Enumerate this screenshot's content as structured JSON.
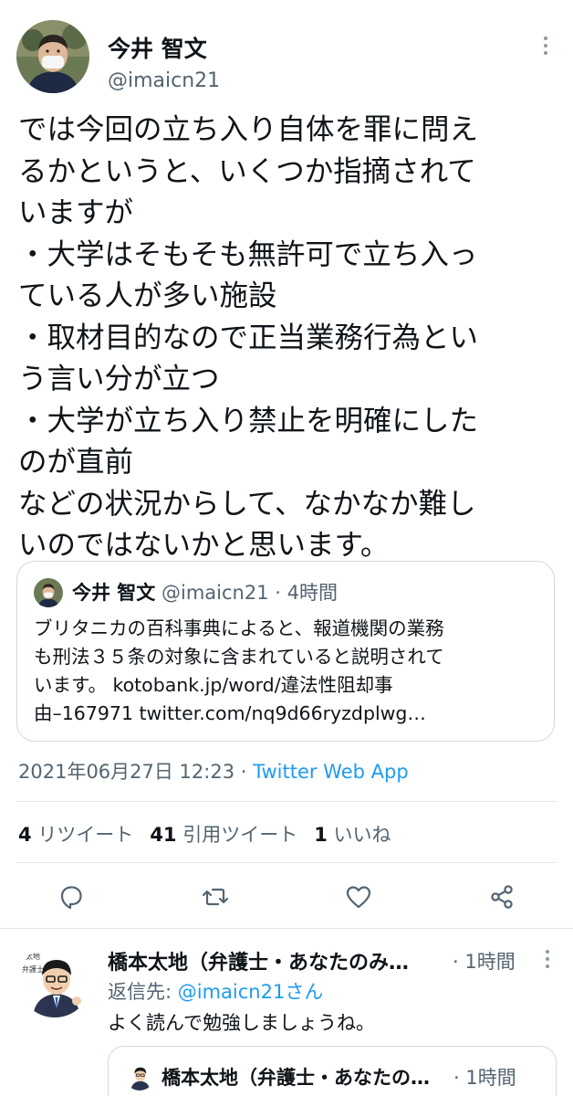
{
  "tweet": {
    "author_name": "今井 智文",
    "author_handle": "@imaicn21",
    "body_lines": [
      "では今回の立ち入り自体を罪に問え",
      "るかというと、いくつか指摘されて",
      "いますが",
      "・大学はそもそも無許可で立ち入っ",
      "ている人が多い施設",
      "・取材目的なので正当業務行為とい",
      "う言い分が立つ",
      "・大学が立ち入り禁止を明確にした",
      "のが直前",
      "などの状況からして、なかなか難し",
      "いのではないかと思います。"
    ],
    "timestamp": "2021年06月27日 12:23",
    "separator": " · ",
    "source": "Twitter Web App",
    "stats": {
      "retweets_count": "4",
      "retweets_label": "リツイート",
      "quotes_count": "41",
      "quotes_label": "引用ツイート",
      "likes_count": "1",
      "likes_label": "いいね"
    }
  },
  "quoted_tweet": {
    "author_name": "今井 智文",
    "author_handle": "@imaicn21",
    "time": "4時間",
    "separator": " · ",
    "body_lines": [
      "ブリタニカの百科事典によると、報道機関の業務",
      "も刑法３５条の対象に含まれていると説明されて",
      "います。 kotobank.jp/word/違法性阻却事",
      "由–167971 twitter.com/nq9d66ryzdplwg…"
    ]
  },
  "actions": {
    "reply_icon": "comment-icon",
    "retweet_icon": "retweet-icon",
    "like_icon": "heart-icon",
    "share_icon": "share-icon"
  },
  "reply": {
    "author_name": "橋本太地（弁護士・あなたのみ…",
    "separator": " · ",
    "time": "1時間",
    "reply_to_label": "返信先: ",
    "reply_to_mention": "@imaicn21さん",
    "text": "よく読んで勉強しましょうね。",
    "quoted": {
      "author_name": "橋本太地（弁護士・あなたの…",
      "separator": " · ",
      "time": "1時間"
    }
  },
  "colors": {
    "text": "#0f1419",
    "secondary": "#536471",
    "link": "#1d9bf0",
    "border": "#cfd9de"
  }
}
